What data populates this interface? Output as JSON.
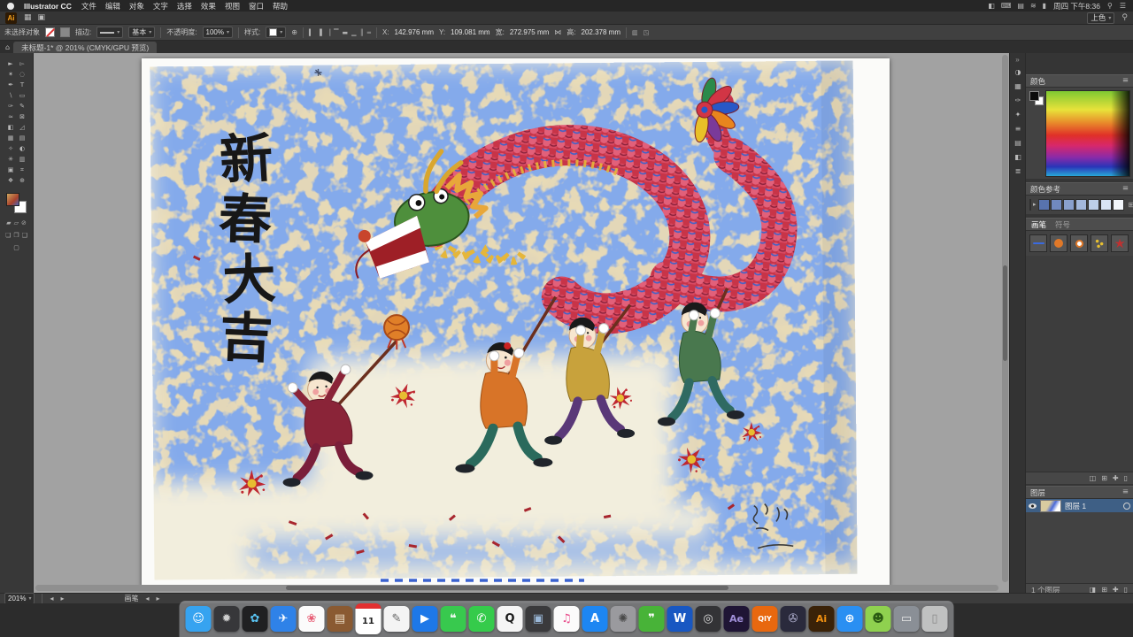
{
  "menubar": {
    "app_name": "Illustrator CC",
    "menus": [
      "文件",
      "编辑",
      "对象",
      "文字",
      "选择",
      "效果",
      "视图",
      "窗口",
      "帮助"
    ],
    "status_icons": [
      {
        "name": "input-source-icon",
        "glyph": "◧"
      },
      {
        "name": "keyboard-icon",
        "glyph": "⌨"
      },
      {
        "name": "display-icon",
        "glyph": "▤"
      },
      {
        "name": "wifi-icon",
        "glyph": "≋"
      },
      {
        "name": "battery-icon",
        "glyph": "▮"
      }
    ],
    "clock": "周四 下午8:36",
    "spotlight_glyph": "⚲",
    "notification_glyph": "☰"
  },
  "appbar": {
    "logo": "Ai",
    "left_icons": [
      {
        "name": "bridge-icon",
        "glyph": "▦"
      },
      {
        "name": "arrange-documents-icon",
        "glyph": "▣"
      }
    ],
    "workspace": "上色"
  },
  "controlbar": {
    "selection_status": "未选择对象",
    "stroke_label": "描边:",
    "brush_preset": "基本",
    "opacity_label": "不透明度:",
    "opacity_value": "100%",
    "style_label": "样式:",
    "doc_setup_glyph": "⊕",
    "align_icons": [
      {
        "name": "align-left-icon",
        "glyph": "▍"
      },
      {
        "name": "align-center-h-icon",
        "glyph": "▐"
      },
      {
        "name": "align-right-icon",
        "glyph": "▕"
      },
      {
        "name": "align-top-icon",
        "glyph": "▔"
      },
      {
        "name": "align-middle-icon",
        "glyph": "▬"
      },
      {
        "name": "align-bottom-icon",
        "glyph": "▁"
      },
      {
        "name": "distribute-h-icon",
        "glyph": "║"
      },
      {
        "name": "distribute-v-icon",
        "glyph": "═"
      }
    ],
    "x_label": "X:",
    "x_value": "142.976 mm",
    "y_label": "Y:",
    "y_value": "109.081 mm",
    "w_label": "宽:",
    "w_value": "272.975 mm",
    "link_glyph": "⋈",
    "h_label": "高:",
    "h_value": "202.378 mm"
  },
  "document_tab": {
    "home_glyph": "⌂",
    "title": "未标题-1* @ 201% (CMYK/GPU 预览)"
  },
  "toolbar": {
    "tools": [
      {
        "name": "selection-tool",
        "glyph": "►"
      },
      {
        "name": "direct-selection-tool",
        "glyph": "▻"
      },
      {
        "name": "magic-wand-tool",
        "glyph": "✶"
      },
      {
        "name": "lasso-tool",
        "glyph": "◌"
      },
      {
        "name": "pen-tool",
        "glyph": "✒"
      },
      {
        "name": "type-tool",
        "glyph": "T"
      },
      {
        "name": "line-segment-tool",
        "glyph": "∖"
      },
      {
        "name": "rectangle-tool",
        "glyph": "▭"
      },
      {
        "name": "paintbrush-tool",
        "glyph": "✑"
      },
      {
        "name": "pencil-tool",
        "glyph": "✎"
      },
      {
        "name": "width-tool",
        "glyph": "≈"
      },
      {
        "name": "free-transform-tool",
        "glyph": "⊠"
      },
      {
        "name": "shape-builder-tool",
        "glyph": "◧"
      },
      {
        "name": "perspective-grid-tool",
        "glyph": "◿"
      },
      {
        "name": "mesh-tool",
        "glyph": "▦"
      },
      {
        "name": "gradient-tool",
        "glyph": "▤"
      },
      {
        "name": "eyedropper-tool",
        "glyph": "✧"
      },
      {
        "name": "blend-tool",
        "glyph": "◐"
      },
      {
        "name": "symbol-sprayer-tool",
        "glyph": "✳"
      },
      {
        "name": "column-graph-tool",
        "glyph": "▥"
      },
      {
        "name": "artboard-tool",
        "glyph": "▣"
      },
      {
        "name": "slice-tool",
        "glyph": "⌗"
      },
      {
        "name": "hand-tool",
        "glyph": "❖"
      },
      {
        "name": "zoom-tool",
        "glyph": "⊕"
      }
    ]
  },
  "canvas": {
    "artwork": {
      "calligraphy": [
        "新",
        "春",
        "大",
        "吉"
      ],
      "palette": {
        "paper": "#e3d7b8",
        "scribble_blue": "#3a62cf",
        "dragon_red": "#c83448",
        "dragon_green": "#4e8f3c",
        "firecracker_red": "#bf2730"
      }
    }
  },
  "panel_strip": {
    "icons": [
      {
        "name": "color-panel-icon",
        "glyph": "◑"
      },
      {
        "name": "swatches-panel-icon",
        "glyph": "▦"
      },
      {
        "name": "brushes-panel-icon",
        "glyph": "✑"
      },
      {
        "name": "symbols-panel-icon",
        "glyph": "✦"
      },
      {
        "name": "stroke-panel-icon",
        "glyph": "≡"
      },
      {
        "name": "gradient-panel-icon",
        "glyph": "▤"
      },
      {
        "name": "transparency-panel-icon",
        "glyph": "◧"
      },
      {
        "name": "appearance-panel-icon",
        "glyph": "≣"
      }
    ],
    "collapse_glyph": "»"
  },
  "panels": {
    "color": {
      "title": "颜色",
      "menu_glyph": "≡"
    },
    "color_guide": {
      "title": "颜色参考",
      "menu_glyph": "≡",
      "base_color": "#4a6ab0",
      "arrow_glyph": "▸",
      "swatches": [
        "#5873ae",
        "#7089bf",
        "#89a0cd",
        "#a3b8dc",
        "#bdcfe9",
        "#d8e4f4",
        "#f2f6fb"
      ]
    },
    "brushes": {
      "tabs": [
        "画笔",
        "符号"
      ],
      "items": [
        "basic-brush",
        "ball-brush",
        "ring-brush",
        "scatter-brush",
        "firework-brush"
      ],
      "footer_icons": [
        {
          "name": "brush-libraries-icon",
          "glyph": "◫"
        },
        {
          "name": "brush-options-icon",
          "glyph": "⊞"
        },
        {
          "name": "new-brush-icon",
          "glyph": "✚"
        },
        {
          "name": "delete-brush-icon",
          "glyph": "▯"
        }
      ]
    },
    "layers": {
      "title": "图层",
      "menu_glyph": "≡",
      "rows": [
        {
          "name": "图层 1"
        }
      ],
      "footer": "1 个图层",
      "footer_icons": [
        {
          "name": "make-mask-icon",
          "glyph": "◨"
        },
        {
          "name": "new-sublayer-icon",
          "glyph": "⊞"
        },
        {
          "name": "new-layer-icon",
          "glyph": "✚"
        },
        {
          "name": "delete-layer-icon",
          "glyph": "▯"
        }
      ]
    }
  },
  "statusbar": {
    "zoom": "201%",
    "nav_prev": "◂",
    "nav_next": "▸",
    "tool": "画笔"
  },
  "dock": {
    "items": [
      {
        "name": "finder",
        "glyph": "☺",
        "bg": "#36a3f0",
        "fg": "#ffffff"
      },
      {
        "name": "launchpad",
        "glyph": "✹",
        "bg": "#37373a",
        "fg": "#cfcfcf"
      },
      {
        "name": "siri",
        "glyph": "✿",
        "bg": "#202022",
        "fg": "#59c3f2"
      },
      {
        "name": "safari",
        "glyph": "✈",
        "bg": "#2f82e8",
        "fg": "#ffffff"
      },
      {
        "name": "photos",
        "glyph": "❀",
        "bg": "#fbfbfb",
        "fg": "#e85d75"
      },
      {
        "name": "box-app",
        "glyph": "▤",
        "bg": "#8a5a32",
        "fg": "#e8d8c0"
      },
      {
        "name": "calendar-november",
        "glyph": "11",
        "bg": "#ffffff",
        "fg": "#222222",
        "accent": "6px solid #e23030",
        "size": "10px"
      },
      {
        "name": "textedit",
        "glyph": "✎",
        "bg": "#f4f4f4",
        "fg": "#666666"
      },
      {
        "name": "video-app",
        "glyph": "▶",
        "bg": "#1e78e8",
        "fg": "#ffffff"
      },
      {
        "name": "messages",
        "glyph": "❝",
        "bg": "#38c94e",
        "fg": "#ffffff"
      },
      {
        "name": "facetime",
        "glyph": "✆",
        "bg": "#35cb4b",
        "fg": "#ffffff"
      },
      {
        "name": "qq",
        "glyph": "Q",
        "bg": "#f5f5f5",
        "fg": "#1a1a1a"
      },
      {
        "name": "screen-mirroring",
        "glyph": "▣",
        "bg": "#3a3a3c",
        "fg": "#9ab8d8"
      },
      {
        "name": "itunes",
        "glyph": "♫",
        "bg": "#fbfbfb",
        "fg": "#e84a8a"
      },
      {
        "name": "app-store",
        "glyph": "A",
        "bg": "#1d86f2",
        "fg": "#ffffff"
      },
      {
        "name": "system-preferences",
        "glyph": "✺",
        "bg": "#9a9a9e",
        "fg": "#4a4a4a"
      },
      {
        "name": "wechat",
        "glyph": "❞",
        "bg": "#48b338",
        "fg": "#ffffff"
      },
      {
        "name": "word",
        "glyph": "W",
        "bg": "#1857c2",
        "fg": "#ffffff"
      },
      {
        "name": "dark-circle-app",
        "glyph": "◎",
        "bg": "#333336",
        "fg": "#dddddd"
      },
      {
        "name": "after-effects",
        "glyph": "Ae",
        "bg": "#1f1535",
        "fg": "#9f8fd8",
        "size": "11px"
      },
      {
        "name": "iqiyi",
        "glyph": "QIY",
        "bg": "#e8680f",
        "fg": "#ffffff",
        "size": "8px"
      },
      {
        "name": "final-cut",
        "glyph": "✇",
        "bg": "#2a2a3c",
        "fg": "#b8b8d8"
      },
      {
        "name": "illustrator",
        "glyph": "Ai",
        "bg": "#3a2208",
        "fg": "#f29111",
        "size": "11px"
      },
      {
        "name": "qq-browser",
        "glyph": "⊕",
        "bg": "#2a8ff2",
        "fg": "#ffffff"
      },
      {
        "name": "android-emulator",
        "glyph": "☻",
        "bg": "#8fd14f",
        "fg": "#2a5a12"
      },
      {
        "name": "minimized-window",
        "glyph": "▭",
        "bg": "#8a8f96",
        "fg": "#e8e8e8"
      },
      {
        "name": "trash",
        "glyph": "▯",
        "bg": "rgba(255,255,255,0.55)",
        "fg": "#8a8a8a"
      }
    ]
  }
}
